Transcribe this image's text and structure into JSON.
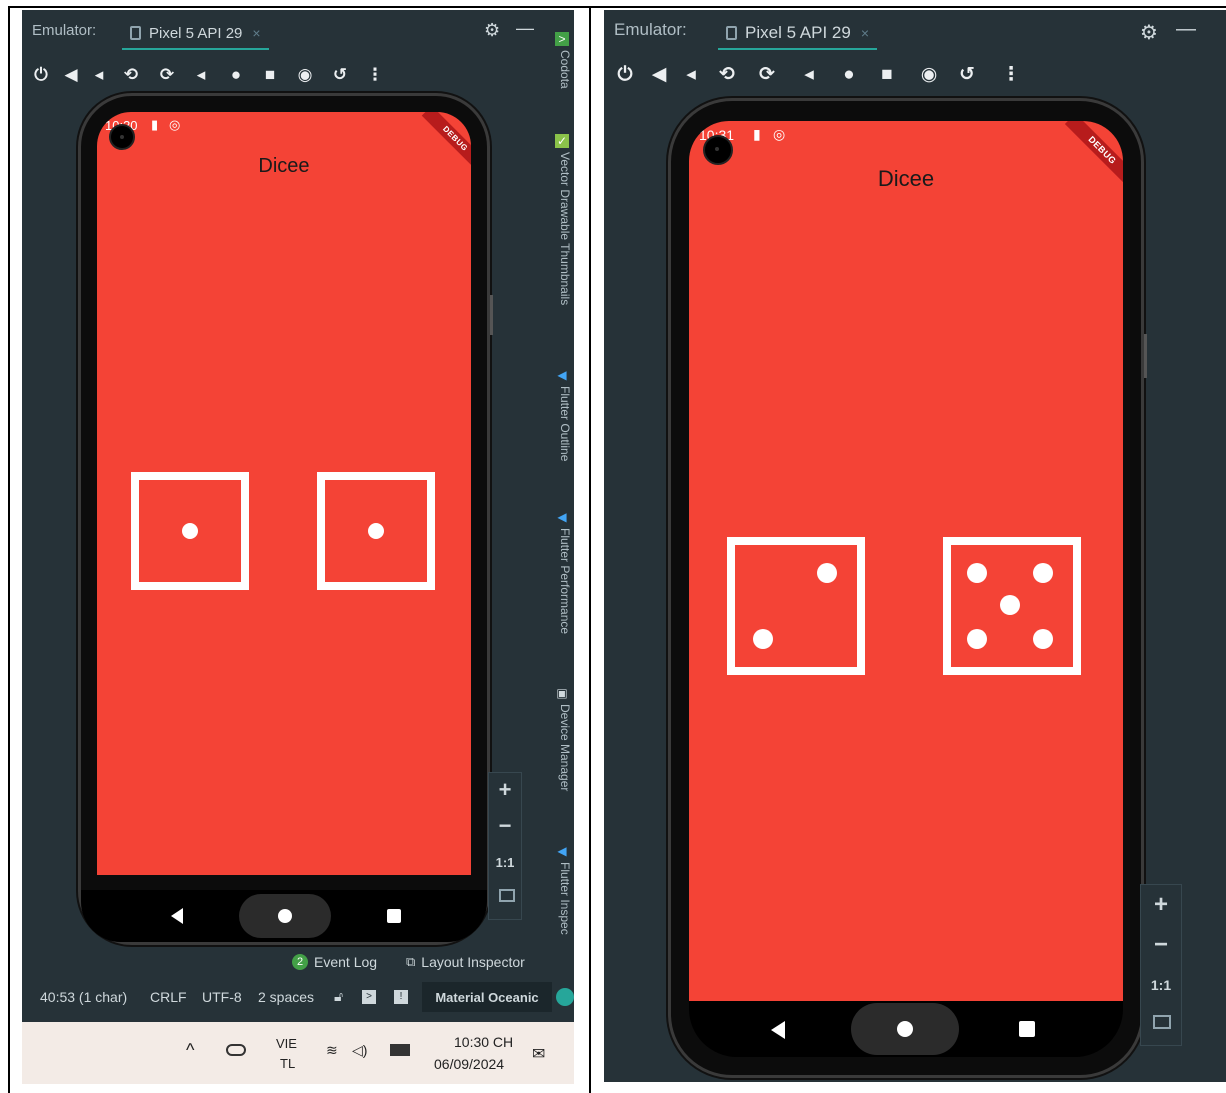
{
  "left": {
    "emulator_label": "Emulator:",
    "device_tab": "Pixel 5 API 29",
    "close_symbol": "×",
    "status_time": "10:30",
    "app_title": "Dicee",
    "debug_label": "DEBUG",
    "dice": [
      1,
      1
    ],
    "zoom": {
      "plus": "+",
      "minus": "−",
      "ratio": "1:1"
    },
    "side_tabs": [
      "Codota",
      "Vector Drawable Thumbnails",
      "Flutter Outline",
      "Flutter Performance",
      "Device Manager",
      "Flutter Inspec"
    ],
    "tool_windows": {
      "event_log_count": "2",
      "event_log": "Event Log",
      "layout_inspector": "Layout Inspector"
    },
    "status": {
      "position": "40:53 (1 char)",
      "line_sep": "CRLF",
      "encoding": "UTF-8",
      "indent": "2 spaces",
      "theme": "Material Oceanic"
    },
    "taskbar": {
      "lang_top": "VIE",
      "lang_bottom": "TL",
      "time": "10:30 CH",
      "date": "06/09/2024"
    }
  },
  "right": {
    "emulator_label": "Emulator:",
    "device_tab": "Pixel 5 API 29",
    "close_symbol": "×",
    "status_time": "10:31",
    "app_title": "Dicee",
    "debug_label": "DEBUG",
    "dice": [
      2,
      5
    ],
    "zoom": {
      "plus": "+",
      "minus": "−",
      "ratio": "1:1"
    }
  },
  "icons": {
    "toolbar": [
      "power-icon",
      "volume-up-icon",
      "volume-down-icon",
      "rotate-left-icon",
      "rotate-right-icon",
      "back-icon",
      "home-icon",
      "overview-icon",
      "screenshot-icon",
      "snapshot-icon",
      "more-icon"
    ],
    "header": [
      "gear-icon",
      "minimize-icon"
    ]
  },
  "colors": {
    "ide_bg": "#263238",
    "app_bg": "#f44336",
    "accent": "#26a69a",
    "die": "#ffffff"
  }
}
